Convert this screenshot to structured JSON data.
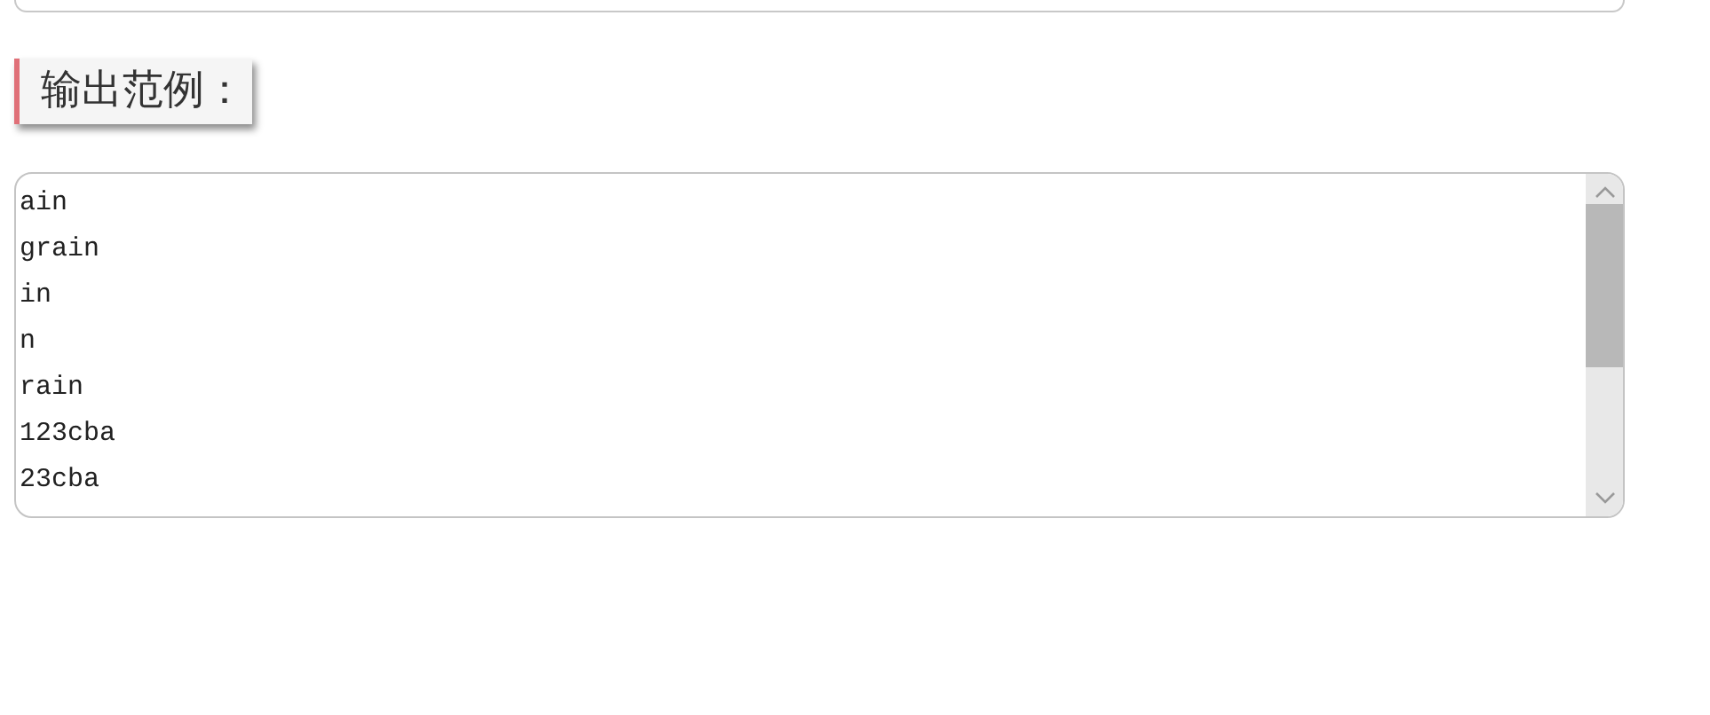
{
  "heading": "输出范例：",
  "output_lines": [
    "ain",
    "grain",
    "in",
    "n",
    "rain",
    "123cba",
    "23cba"
  ]
}
